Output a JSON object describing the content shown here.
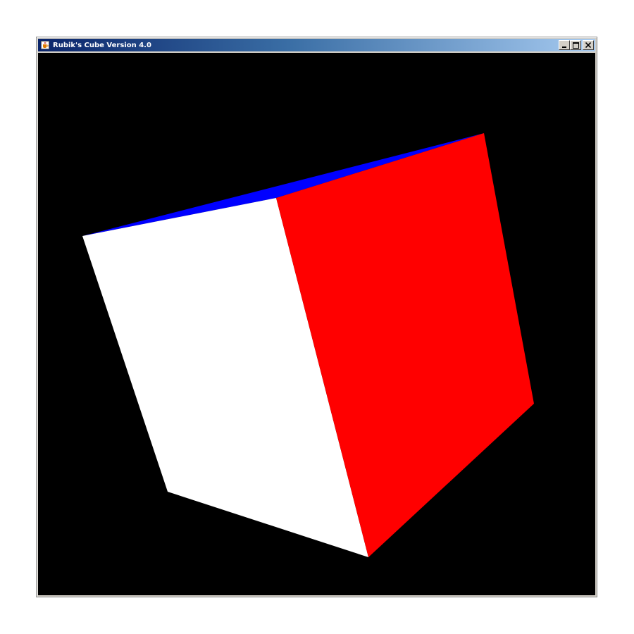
{
  "window": {
    "title": "Rubik's Cube Version 4.0",
    "app_icon": "java-coffee-cup-icon",
    "controls": {
      "minimize_icon": "minimize-icon",
      "maximize_icon": "maximize-icon",
      "close_icon": "close-icon"
    }
  },
  "scene": {
    "background_color": "#000000",
    "faces": [
      {
        "name": "top",
        "color": "#0000ff"
      },
      {
        "name": "front",
        "color": "#ffffff"
      },
      {
        "name": "right",
        "color": "#ff0000"
      }
    ]
  }
}
